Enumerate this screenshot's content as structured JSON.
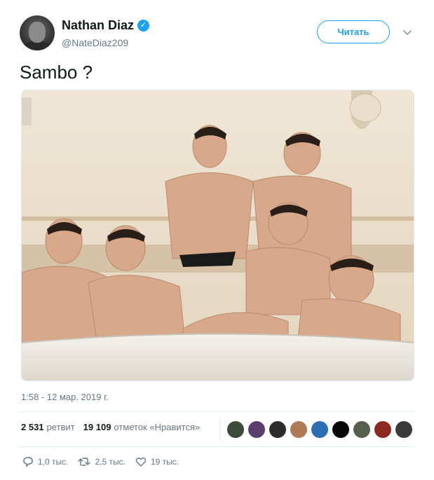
{
  "user": {
    "name": "Nathan Diaz",
    "handle": "@NateDiaz209",
    "verified": true
  },
  "follow_button": {
    "label": "Читать"
  },
  "tweet": {
    "text": "Sambo ?",
    "timestamp": "1:58 - 12 мар. 2019 г."
  },
  "stats": {
    "retweets_count": "2 531",
    "retweets_label": "ретвит",
    "likes_count": "19 109",
    "likes_label": "отметок «Нравится»"
  },
  "likers": [
    {
      "icon": "liker-avatar",
      "color": "#3b4a3a"
    },
    {
      "icon": "liker-avatar",
      "color": "#5a3f6e"
    },
    {
      "icon": "liker-avatar",
      "color": "#2c2c2c"
    },
    {
      "icon": "liker-avatar",
      "color": "#b07a54"
    },
    {
      "icon": "liker-avatar",
      "color": "#2d6fb3"
    },
    {
      "icon": "liker-avatar",
      "color": "#050505"
    },
    {
      "icon": "liker-avatar",
      "color": "#56604c"
    },
    {
      "icon": "liker-avatar",
      "color": "#8c2a22"
    },
    {
      "icon": "liker-avatar",
      "color": "#3a3a3a"
    }
  ],
  "actions": {
    "replies": "1,0 тыс.",
    "retweets": "2,5 тыс.",
    "likes": "19 тыс."
  },
  "colors": {
    "accent": "#1da1f2",
    "text": "#14171a",
    "secondary": "#657786"
  }
}
